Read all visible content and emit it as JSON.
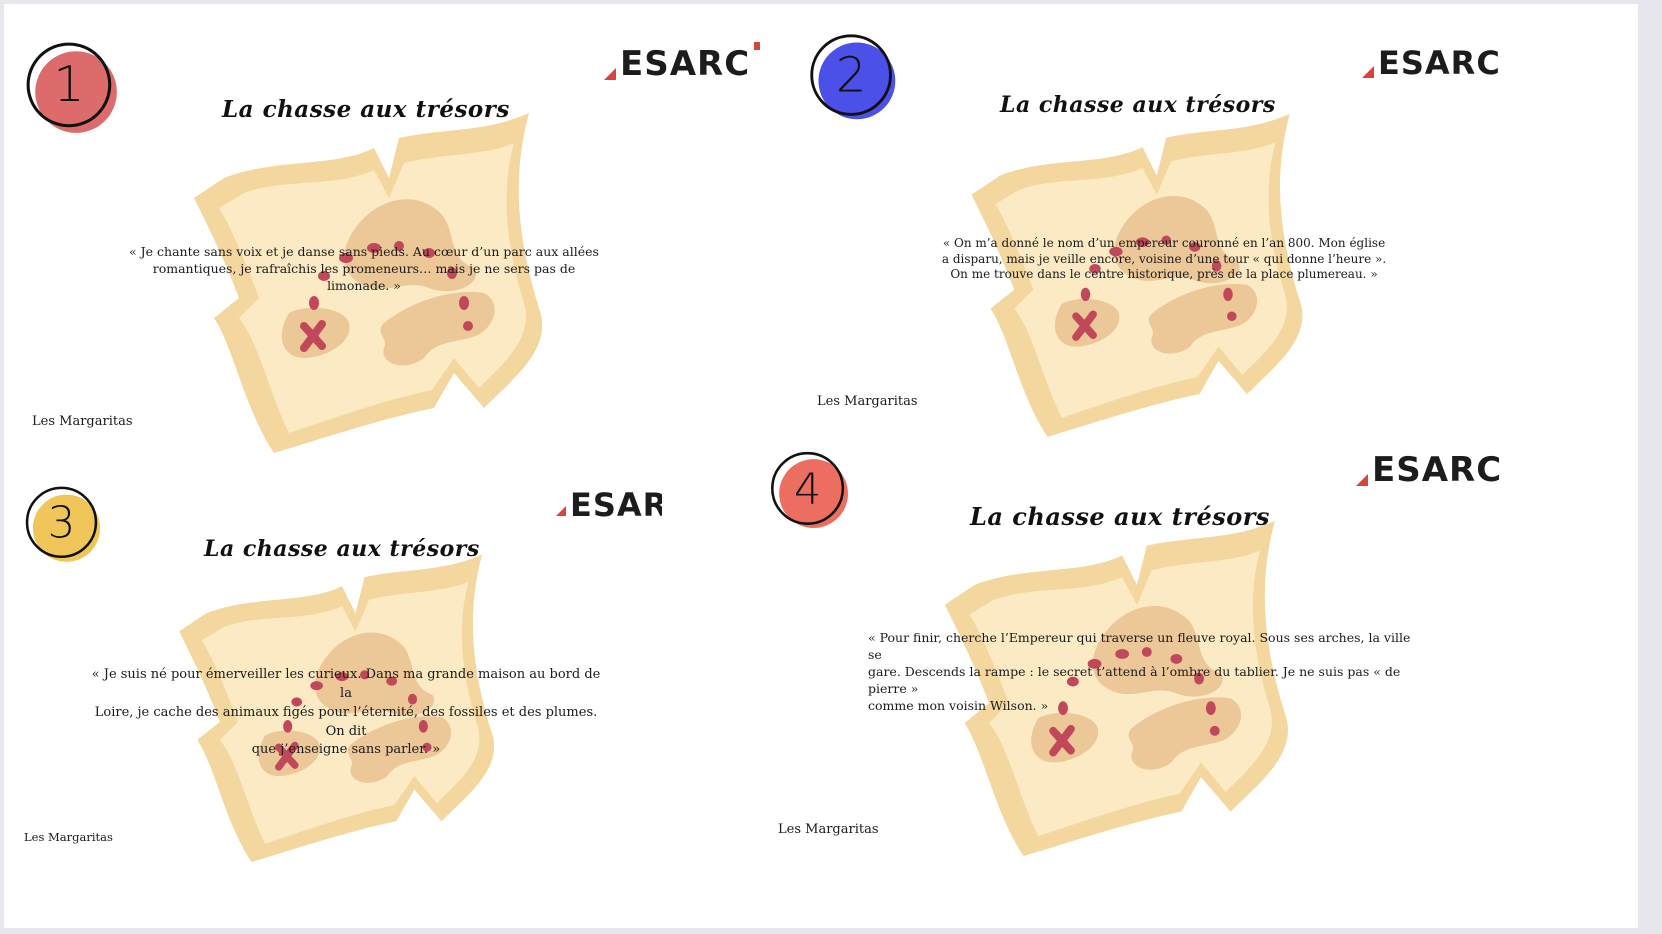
{
  "brand": {
    "logo_text": "ESARC",
    "accent": "#d9443a"
  },
  "cards": [
    {
      "number": "1",
      "badge_color": "#de6b6b",
      "title": "La chasse aux trésors",
      "riddle": [
        "« Je chante sans voix et je danse sans pieds. Au cœur d’un parc aux allées",
        "romantiques, je rafraîchis les promeneurs… mais je ne sers pas de limonade. »"
      ],
      "signature": "Les Margaritas"
    },
    {
      "number": "2",
      "badge_color": "#4a50e8",
      "title": "La chasse aux trésors",
      "riddle": [
        "« On m’a donné le nom d’un empereur couronné en l’an 800. Mon église",
        "a disparu, mais je veille encore, voisine d’une tour « qui donne l’heure ».",
        "On me trouve dans le centre historique, près de la place plumereau. »"
      ],
      "signature": "Les Margaritas"
    },
    {
      "number": "3",
      "badge_color": "#f0c65a",
      "title": "La chasse aux trésors",
      "riddle": [
        "« Je suis né pour émerveiller les curieux. Dans ma grande maison au bord de la",
        "Loire, je cache des animaux figés pour l’éternité, des fossiles et des plumes. On dit",
        "que j’enseigne sans parler. »"
      ],
      "signature": "Les Margaritas"
    },
    {
      "number": "4",
      "badge_color": "#ec6e60",
      "title": "La chasse aux trésors",
      "riddle": [
        "« Pour finir, cherche l’Empereur qui traverse un fleuve royal. Sous ses arches, la ville se",
        "gare. Descends la rampe : le secret t’attend à l’ombre du tablier. Je ne suis pas « de pierre »",
        "comme mon voisin Wilson. »"
      ],
      "signature": "Les Margaritas"
    }
  ],
  "icons": {
    "badge": "hand-drawn-number-circle",
    "map": "treasure-map-illustration",
    "logo_mark": "red-triangle"
  },
  "colors": {
    "parchment_light": "#fbeac4",
    "parchment_mid": "#f3d79e",
    "island": "#ecc797",
    "trail": "#c0485a"
  }
}
